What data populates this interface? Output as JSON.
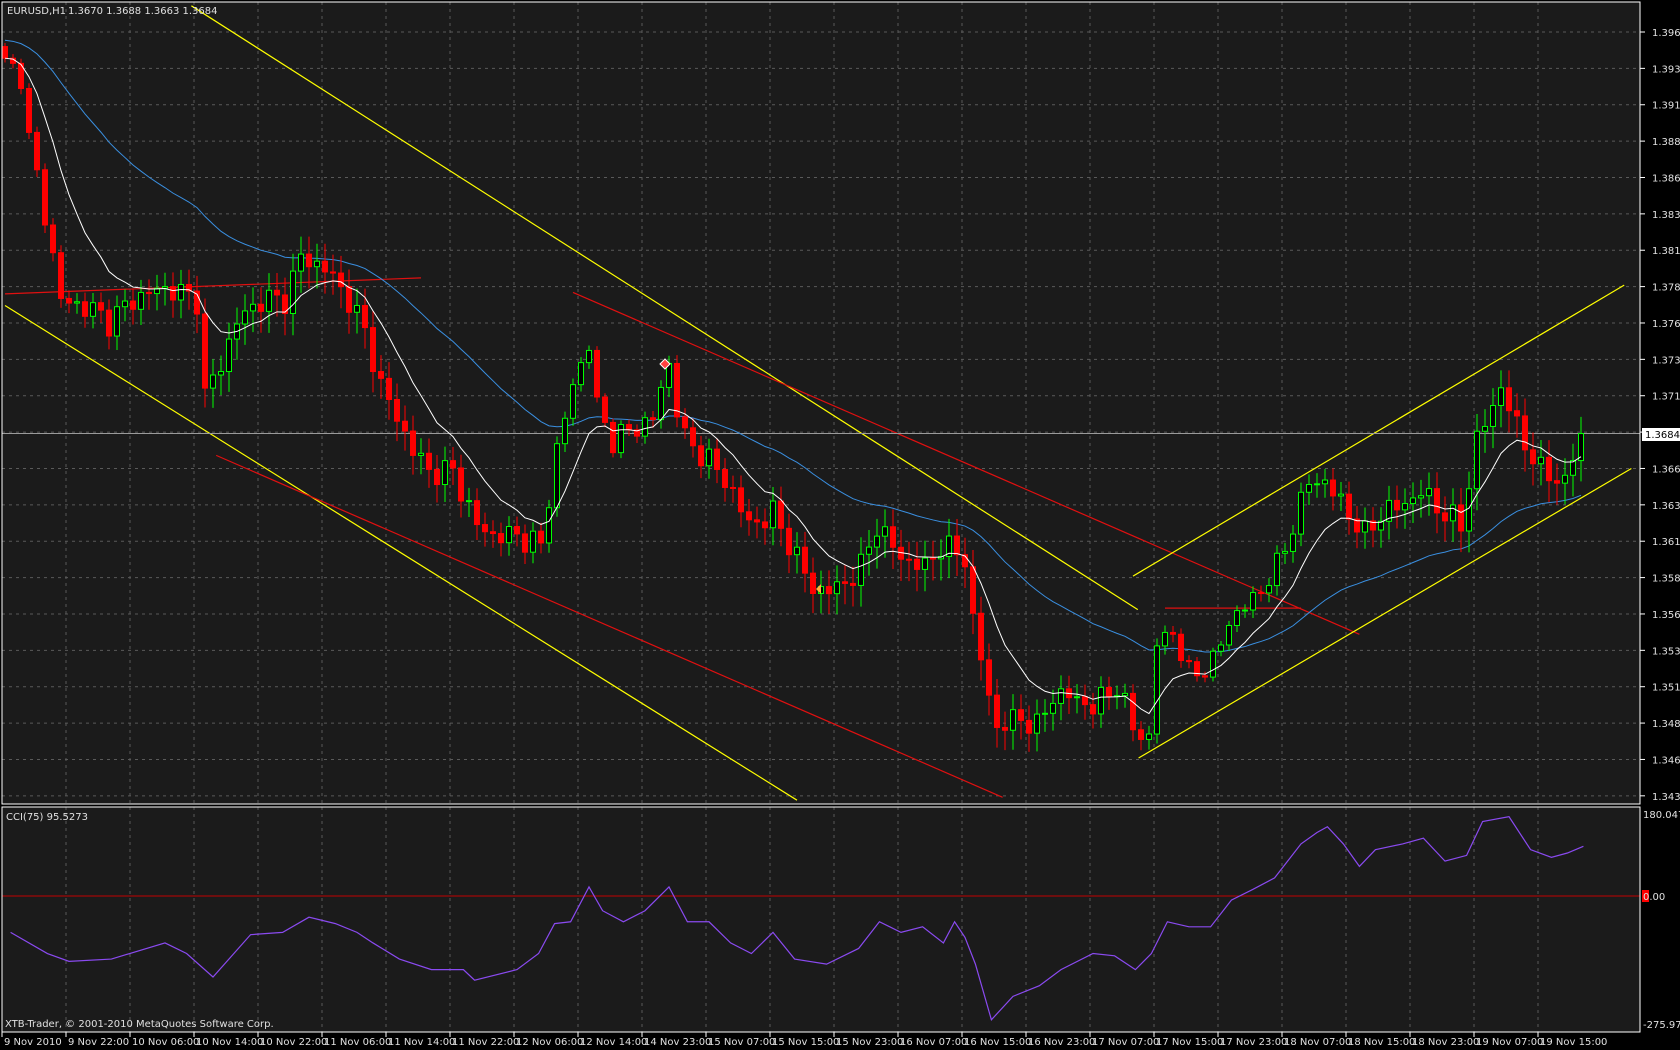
{
  "header": {
    "symbol": "EURUSD,H1",
    "ohlc": "1.3670 1.3688 1.3663 1.3684"
  },
  "indicator": {
    "label": "CCI(75) 95.5273",
    "max_label": "180.0477",
    "zero_label": "0.00",
    "min_label": "-275.975"
  },
  "footer": {
    "copyright": "XTB-Trader, © 2001-2010 MetaQuotes Software Corp."
  },
  "current_price_label": "1.3684",
  "colors": {
    "background": "#1b1b1b",
    "frame": "#ffffff",
    "grid": "#5a5a5a",
    "bull": "#00ff00",
    "bear": "#ff0000",
    "ma_fast": "#ffffff",
    "ma_slow": "#3a8fe0",
    "cci": "#8a4af0",
    "trend_yellow": "#ffff00",
    "trend_red": "#e01010"
  },
  "chart_data": {
    "type": "candlestick",
    "title": "EURUSD,H1",
    "price_ticks": [
      "1.3960",
      "1.3935",
      "1.3910",
      "1.3885",
      "1.3860",
      "1.3835",
      "1.3810",
      "1.3785",
      "1.3760",
      "1.3735",
      "1.3710",
      "1.3685",
      "1.3660",
      "1.3635",
      "1.3610",
      "1.3585",
      "1.3560",
      "1.3535",
      "1.3510",
      "1.3485",
      "1.3460",
      "1.3435"
    ],
    "price_ticks_shown": [
      "1.3960",
      "1.3935",
      "1.3910",
      "1.3885",
      "1.3860",
      "1.3835",
      "1.3810",
      "1.3785",
      "1.3760",
      "1.3735",
      "1.3710",
      "1.3660",
      "1.3635",
      "1.3610",
      "1.3585",
      "1.3560",
      "1.3535",
      "1.3510",
      "1.3485",
      "1.3460",
      "1.3435"
    ],
    "ylim": [
      1.3426,
      1.3982
    ],
    "bars": 198,
    "current_price": 1.3684,
    "time_labels": [
      "9 Nov 2010",
      "9 Nov 22:00",
      "10 Nov 06:00",
      "10 Nov 14:00",
      "10 Nov 22:00",
      "11 Nov 06:00",
      "11 Nov 14:00",
      "11 Nov 22:00",
      "12 Nov 06:00",
      "12 Nov 14:00",
      "14 Nov 23:00",
      "15 Nov 07:00",
      "15 Nov 15:00",
      "15 Nov 23:00",
      "16 Nov 07:00",
      "16 Nov 15:00",
      "16 Nov 23:00",
      "17 Nov 07:00",
      "17 Nov 15:00",
      "17 Nov 23:00",
      "18 Nov 07:00",
      "18 Nov 15:00",
      "18 Nov 23:00",
      "19 Nov 07:00",
      "19 Nov 15:00"
    ],
    "bars_per_time_label": 8,
    "close_keypoints": [
      [
        0,
        1.3938
      ],
      [
        2,
        1.3931
      ],
      [
        3,
        1.3886
      ],
      [
        5,
        1.3835
      ],
      [
        7,
        1.3776
      ],
      [
        11,
        1.3769
      ],
      [
        13,
        1.3761
      ],
      [
        16,
        1.3776
      ],
      [
        19,
        1.3783
      ],
      [
        21,
        1.3783
      ],
      [
        24,
        1.3776
      ],
      [
        25,
        1.371
      ],
      [
        27,
        1.3732
      ],
      [
        29,
        1.3761
      ],
      [
        32,
        1.3776
      ],
      [
        35,
        1.3776
      ],
      [
        37,
        1.3805
      ],
      [
        40,
        1.3798
      ],
      [
        43,
        1.3776
      ],
      [
        45,
        1.3754
      ],
      [
        47,
        1.3717
      ],
      [
        49,
        1.3695
      ],
      [
        51,
        1.3673
      ],
      [
        53,
        1.3658
      ],
      [
        56,
        1.3658
      ],
      [
        59,
        1.3621
      ],
      [
        61,
        1.3614
      ],
      [
        64,
        1.3614
      ],
      [
        67,
        1.3607
      ],
      [
        69,
        1.3673
      ],
      [
        71,
        1.3717
      ],
      [
        73,
        1.3747
      ],
      [
        74,
        1.3702
      ],
      [
        76,
        1.368
      ],
      [
        79,
        1.3688
      ],
      [
        81,
        1.3695
      ],
      [
        83,
        1.3732
      ],
      [
        84,
        1.3702
      ],
      [
        85,
        1.368
      ],
      [
        88,
        1.3666
      ],
      [
        91,
        1.3644
      ],
      [
        93,
        1.3621
      ],
      [
        96,
        1.3629
      ],
      [
        99,
        1.3599
      ],
      [
        101,
        1.3577
      ],
      [
        104,
        1.3577
      ],
      [
        107,
        1.3592
      ],
      [
        109,
        1.3621
      ],
      [
        112,
        1.3599
      ],
      [
        115,
        1.3592
      ],
      [
        117,
        1.3607
      ],
      [
        120,
        1.3599
      ],
      [
        121,
        1.3555
      ],
      [
        123,
        1.3504
      ],
      [
        124,
        1.3482
      ],
      [
        127,
        1.3489
      ],
      [
        129,
        1.3482
      ],
      [
        131,
        1.3504
      ],
      [
        133,
        1.3504
      ],
      [
        136,
        1.3496
      ],
      [
        139,
        1.3511
      ],
      [
        141,
        1.3482
      ],
      [
        143,
        1.3474
      ],
      [
        144,
        1.354
      ],
      [
        146,
        1.3548
      ],
      [
        148,
        1.3518
      ],
      [
        151,
        1.3526
      ],
      [
        153,
        1.3555
      ],
      [
        156,
        1.357
      ],
      [
        159,
        1.3592
      ],
      [
        161,
        1.3621
      ],
      [
        163,
        1.3651
      ],
      [
        165,
        1.3651
      ],
      [
        168,
        1.3629
      ],
      [
        170,
        1.3614
      ],
      [
        172,
        1.3629
      ],
      [
        175,
        1.3636
      ],
      [
        177,
        1.3644
      ],
      [
        180,
        1.3629
      ],
      [
        182,
        1.3621
      ],
      [
        184,
        1.368
      ],
      [
        186,
        1.3702
      ],
      [
        187,
        1.3717
      ],
      [
        189,
        1.3688
      ],
      [
        192,
        1.3658
      ],
      [
        195,
        1.3651
      ],
      [
        197,
        1.3684
      ]
    ],
    "moving_averages": [
      {
        "name": "fast MA",
        "period": 10
      },
      {
        "name": "slow MA",
        "period": 40
      }
    ],
    "trendlines": [
      {
        "color": "yellow",
        "from": [
          0,
          1.3772
        ],
        "to": [
          99,
          1.3432
        ]
      },
      {
        "color": "yellow",
        "from": [
          23.3,
          1.3978
        ],
        "to": [
          141.6,
          1.3563
        ]
      },
      {
        "color": "red",
        "from": [
          26.4,
          1.3669
        ],
        "to": [
          124.7,
          1.3434
        ]
      },
      {
        "color": "red",
        "from": [
          71,
          1.3781
        ],
        "to": [
          169.3,
          1.3546
        ]
      },
      {
        "color": "red",
        "from": [
          0,
          1.378
        ],
        "to": [
          52,
          1.3791
        ]
      },
      {
        "color": "red",
        "from": [
          145,
          1.3564
        ],
        "to": [
          162,
          1.3564
        ]
      },
      {
        "color": "yellow",
        "from": [
          141,
          1.3586
        ],
        "to": [
          202.4,
          1.3786
        ]
      },
      {
        "color": "yellow",
        "from": [
          141.7,
          1.3461
        ],
        "to": [
          203.3,
          1.366
        ]
      }
    ],
    "cci": {
      "name": "CCI(75)",
      "last": 95.5273,
      "ylim": [
        -275.975,
        180.0477
      ],
      "keypoints": [
        [
          0.7,
          -79
        ],
        [
          5.3,
          -125
        ],
        [
          8,
          -142
        ],
        [
          13.3,
          -137
        ],
        [
          20,
          -102
        ],
        [
          22.7,
          -125
        ],
        [
          26,
          -176
        ],
        [
          30.7,
          -84
        ],
        [
          34.7,
          -79
        ],
        [
          38,
          -46
        ],
        [
          41.3,
          -60
        ],
        [
          44,
          -79
        ],
        [
          46,
          -102
        ],
        [
          49.3,
          -137
        ],
        [
          53.3,
          -160
        ],
        [
          57.3,
          -160
        ],
        [
          58.7,
          -183
        ],
        [
          64,
          -160
        ],
        [
          66.7,
          -125
        ],
        [
          68.7,
          -60
        ],
        [
          70.7,
          -56
        ],
        [
          73,
          19
        ],
        [
          74.7,
          -32
        ],
        [
          77.3,
          -56
        ],
        [
          80,
          -32
        ],
        [
          83,
          19
        ],
        [
          85.3,
          -56
        ],
        [
          88,
          -56
        ],
        [
          90.7,
          -102
        ],
        [
          93.3,
          -125
        ],
        [
          96,
          -79
        ],
        [
          98.7,
          -137
        ],
        [
          102.7,
          -148
        ],
        [
          106.7,
          -114
        ],
        [
          109.3,
          -56
        ],
        [
          112,
          -79
        ],
        [
          114.7,
          -67
        ],
        [
          117.3,
          -102
        ],
        [
          118.7,
          -56
        ],
        [
          120,
          -90
        ],
        [
          121.3,
          -148
        ],
        [
          123.3,
          -269
        ],
        [
          126,
          -218
        ],
        [
          129.3,
          -195
        ],
        [
          132,
          -160
        ],
        [
          136,
          -125
        ],
        [
          138.7,
          -130
        ],
        [
          141.3,
          -160
        ],
        [
          143.3,
          -125
        ],
        [
          145.3,
          -56
        ],
        [
          148,
          -67
        ],
        [
          150.7,
          -67
        ],
        [
          153.3,
          -9
        ],
        [
          156,
          14
        ],
        [
          158.7,
          38
        ],
        [
          162,
          109
        ],
        [
          164,
          133
        ],
        [
          165.3,
          145
        ],
        [
          167.3,
          109
        ],
        [
          169.3,
          62
        ],
        [
          171.3,
          97
        ],
        [
          174.7,
          109
        ],
        [
          177.3,
          121
        ],
        [
          180,
          73
        ],
        [
          182.7,
          85
        ],
        [
          184.7,
          156
        ],
        [
          188,
          166
        ],
        [
          190.7,
          97
        ],
        [
          193.3,
          81
        ],
        [
          195.3,
          90
        ],
        [
          197.3,
          104
        ]
      ]
    }
  }
}
